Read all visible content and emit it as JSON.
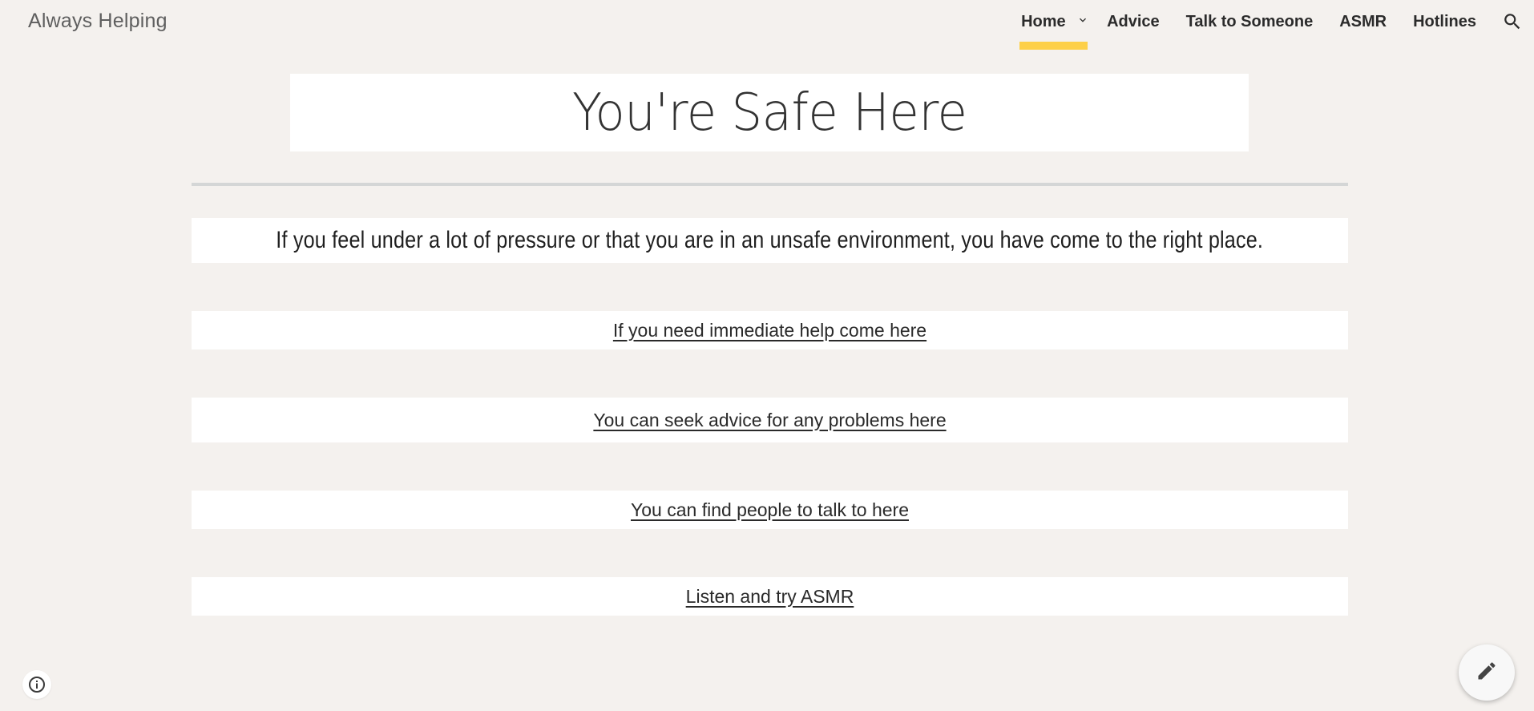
{
  "site": {
    "title": "Always Helping"
  },
  "nav": {
    "items": [
      {
        "label": "Home",
        "active": true,
        "has_dropdown": true
      },
      {
        "label": "Advice"
      },
      {
        "label": "Talk to Someone"
      },
      {
        "label": "ASMR"
      },
      {
        "label": "Hotlines"
      }
    ],
    "search_icon": "search-icon",
    "dropdown_icon": "chevron-down-icon",
    "active_indicator_color": "#fdd049"
  },
  "main": {
    "title": "You're Safe Here",
    "intro": "If you feel under a lot of pressure or that you are in an unsafe environment, you have come to the right place.",
    "links": [
      {
        "label": "If you need immediate help come here"
      },
      {
        "label": "You can seek advice for any problems here"
      },
      {
        "label": "You can find people to talk to here"
      },
      {
        "label": "Listen and try ASMR"
      }
    ]
  },
  "footer": {
    "info_icon": "info-icon",
    "edit_icon": "pencil-icon"
  },
  "colors": {
    "background": "#f4f1ee",
    "accent": "#fdd049",
    "panel": "#ffffff"
  }
}
